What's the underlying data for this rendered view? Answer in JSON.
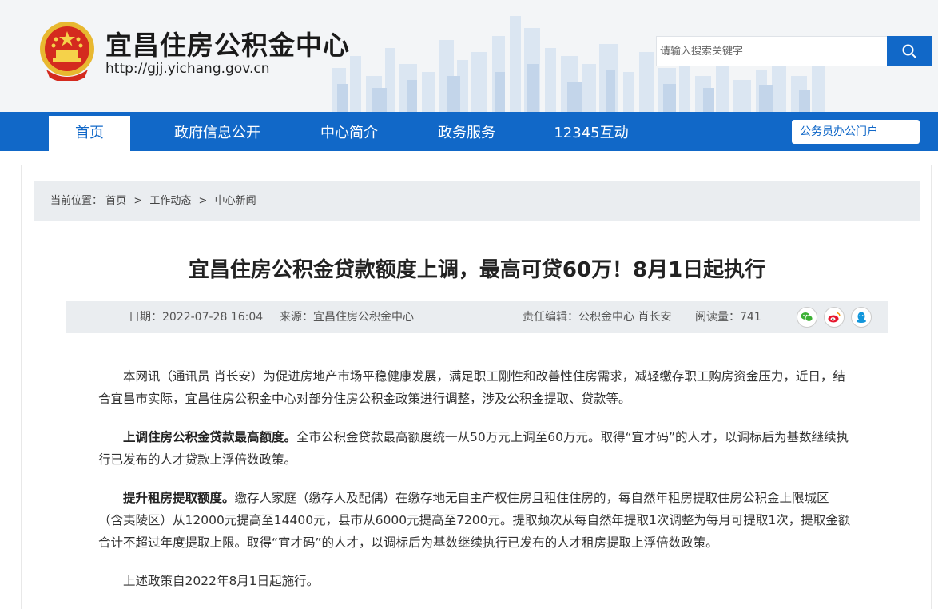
{
  "header": {
    "site_title": "宜昌住房公积金中心",
    "site_url": "http://gjj.yichang.gov.cn",
    "search_placeholder": "请输入搜索关键字",
    "brand_color": "#1168c8"
  },
  "nav": {
    "items": [
      {
        "label": "首页",
        "active": true
      },
      {
        "label": "政府信息公开",
        "active": false
      },
      {
        "label": "中心简介",
        "active": false
      },
      {
        "label": "政务服务",
        "active": false
      },
      {
        "label": "12345互动",
        "active": false
      }
    ],
    "portal_label": "公务员办公门户"
  },
  "breadcrumb": {
    "prefix": "当前位置：",
    "items": [
      "首页",
      "工作动态",
      "中心新闻"
    ],
    "separator": ">"
  },
  "article": {
    "title": "宜昌住房公积金贷款额度上调，最高可贷60万！8月1日起执行",
    "date": "日期：2022-07-28 16:04",
    "source": "来源：宜昌住房公积金中心",
    "editor": "责任编辑：公积金中心 肖长安",
    "views": "阅读量：741",
    "share_icons": [
      "wechat-icon",
      "weibo-icon",
      "qq-icon"
    ],
    "paragraphs": [
      {
        "bold": "",
        "text": "本网讯（通讯员 肖长安）为促进房地产市场平稳健康发展，满足职工刚性和改善性住房需求，减轻缴存职工购房资金压力，近日，结合宜昌市实际，宜昌住房公积金中心对部分住房公积金政策进行调整，涉及公积金提取、贷款等。"
      },
      {
        "bold": "上调住房公积金贷款最高额度。",
        "text": "全市公积金贷款最高额度统一从50万元上调至60万元。取得“宜才码”的人才，以调标后为基数继续执行已发布的人才贷款上浮倍数政策。"
      },
      {
        "bold": "提升租房提取额度。",
        "text": "缴存人家庭（缴存人及配偶）在缴存地无自主产权住房且租住住房的，每自然年租房提取住房公积金上限城区（含夷陵区）从12000元提高至14400元，县市从6000元提高至7200元。提取频次从每自然年提取1次调整为每月可提取1次，提取金额合计不超过年度提取上限。取得“宜才码”的人才，以调标后为基数继续执行已发布的人才租房提取上浮倍数政策。"
      },
      {
        "bold": "",
        "text": "上述政策自2022年8月1日起施行。"
      }
    ]
  }
}
